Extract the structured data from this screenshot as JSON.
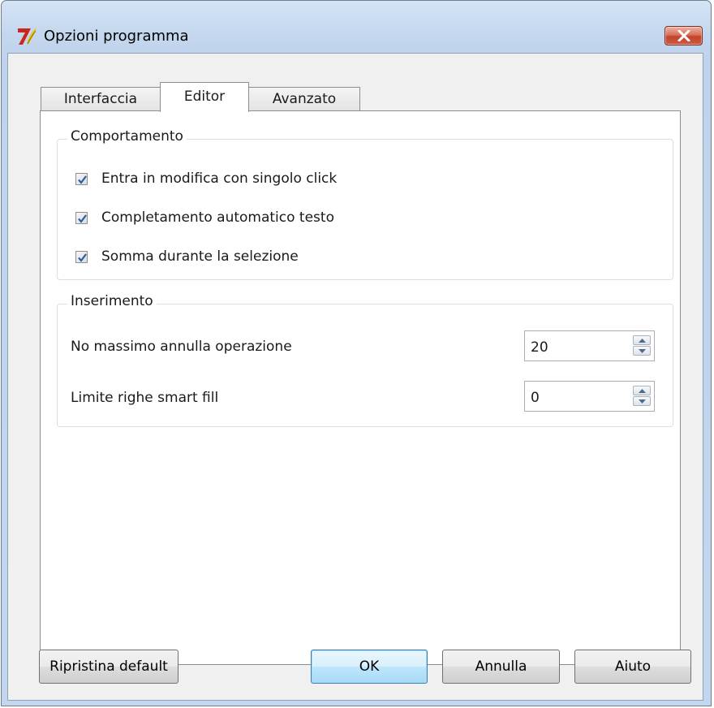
{
  "window": {
    "title": "Opzioni programma"
  },
  "tabs": [
    {
      "label": "Interfaccia",
      "active": false
    },
    {
      "label": "Editor",
      "active": true
    },
    {
      "label": "Avanzato",
      "active": false
    }
  ],
  "behavior_group": {
    "title": "Comportamento",
    "options": [
      {
        "label": "Entra in modifica con singolo click",
        "checked": true
      },
      {
        "label": "Completamento automatico testo",
        "checked": true
      },
      {
        "label": "Somma durante la selezione",
        "checked": true
      }
    ]
  },
  "insert_group": {
    "title": "Inserimento",
    "fields": [
      {
        "label": "No massimo annulla operazione",
        "value": "20"
      },
      {
        "label": "Limite righe smart fill",
        "value": "0"
      }
    ]
  },
  "buttons": {
    "reset": "Ripristina default",
    "ok": "OK",
    "cancel": "Annulla",
    "help": "Aiuto"
  },
  "icons": {
    "app": "app-logo-icon",
    "close": "close-icon",
    "check": "checkmark-icon",
    "spin_up": "spin-up-icon",
    "spin_down": "spin-down-icon"
  },
  "colors": {
    "window_frame": "#c4d7ee",
    "close_button": "#c2432b",
    "default_button": "#bee6fd",
    "check_mark": "#2a5ea5"
  }
}
